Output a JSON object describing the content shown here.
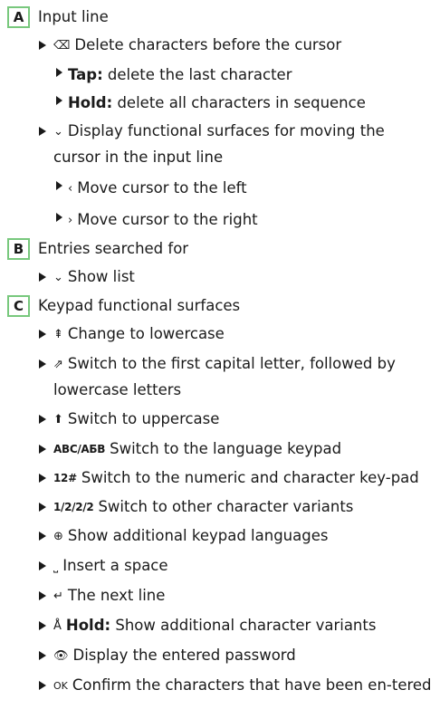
{
  "colors": {
    "badge_border": "#78c87d",
    "text": "#1a1a1a"
  },
  "sections": {
    "A": {
      "letter": "A",
      "title": "Input line",
      "delete_icon": "⌫",
      "delete_text": "Delete characters before the cursor",
      "tap_label": "Tap:",
      "tap_text": " delete the last character",
      "hold_label": "Hold:",
      "hold_text": " delete all characters in sequence",
      "chevron_down_icon": "⌄",
      "display_text": "Display functional surfaces for moving the cursor in the input line",
      "left_icon": "‹",
      "left_text": "Move cursor to the left",
      "right_icon": "›",
      "right_text": "Move cursor to the right"
    },
    "B": {
      "letter": "B",
      "title": "Entries searched for",
      "chevron_down_icon": "⌄",
      "show_list": "Show list"
    },
    "C": {
      "letter": "C",
      "title": "Keypad functional surfaces",
      "items": [
        {
          "icon": "⇞",
          "text": "Change to lowercase"
        },
        {
          "icon": "⇗",
          "text": "Switch to the first capital letter, followed by lowercase letters"
        },
        {
          "icon": "⬆",
          "text": "Switch to uppercase"
        },
        {
          "icon": "ABC/АБВ",
          "text": "Switch to the language keypad"
        },
        {
          "icon": "12#",
          "text": "Switch to the numeric and character key-pad"
        },
        {
          "icon": "1/2/2/2",
          "text": "Switch to other character variants"
        },
        {
          "icon": "⊕",
          "text": "Show additional keypad languages"
        },
        {
          "icon": "⎵",
          "text": "Insert a space"
        },
        {
          "icon": "↵",
          "text": "The next line"
        },
        {
          "icon": "Å",
          "label": "Hold:",
          "text": " Show additional character variants"
        },
        {
          "icon": "👁",
          "text": "Display the entered password"
        },
        {
          "icon": "OK",
          "text": "Confirm the characters that have been en-tered"
        }
      ]
    }
  }
}
